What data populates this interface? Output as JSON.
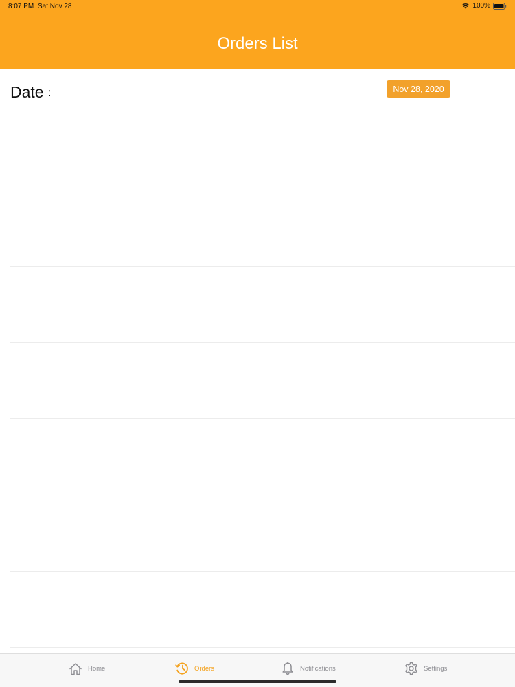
{
  "status_bar": {
    "time": "8:07 PM",
    "date": "Sat Nov 28",
    "battery_percent": "100%",
    "battery_level": 1.0
  },
  "header": {
    "title": "Orders List",
    "background_color": "#fca51e"
  },
  "date_filter": {
    "label": "Date",
    "separator": ":",
    "value": "Nov 28, 2020",
    "button_color": "#f2a12b"
  },
  "orders": [
    {
      "text": ""
    },
    {
      "text": ""
    },
    {
      "text": ""
    },
    {
      "text": ""
    },
    {
      "text": ""
    },
    {
      "text": ""
    },
    {
      "text": ""
    }
  ],
  "tabbar": {
    "active_color": "#f4a21e",
    "inactive_color": "#8e8e93",
    "items": [
      {
        "label": "Home",
        "icon": "home-icon",
        "active": false
      },
      {
        "label": "Orders",
        "icon": "history-icon",
        "active": true
      },
      {
        "label": "Notifications",
        "icon": "bell-icon",
        "active": false
      },
      {
        "label": "Settings",
        "icon": "gear-icon",
        "active": false
      }
    ]
  }
}
